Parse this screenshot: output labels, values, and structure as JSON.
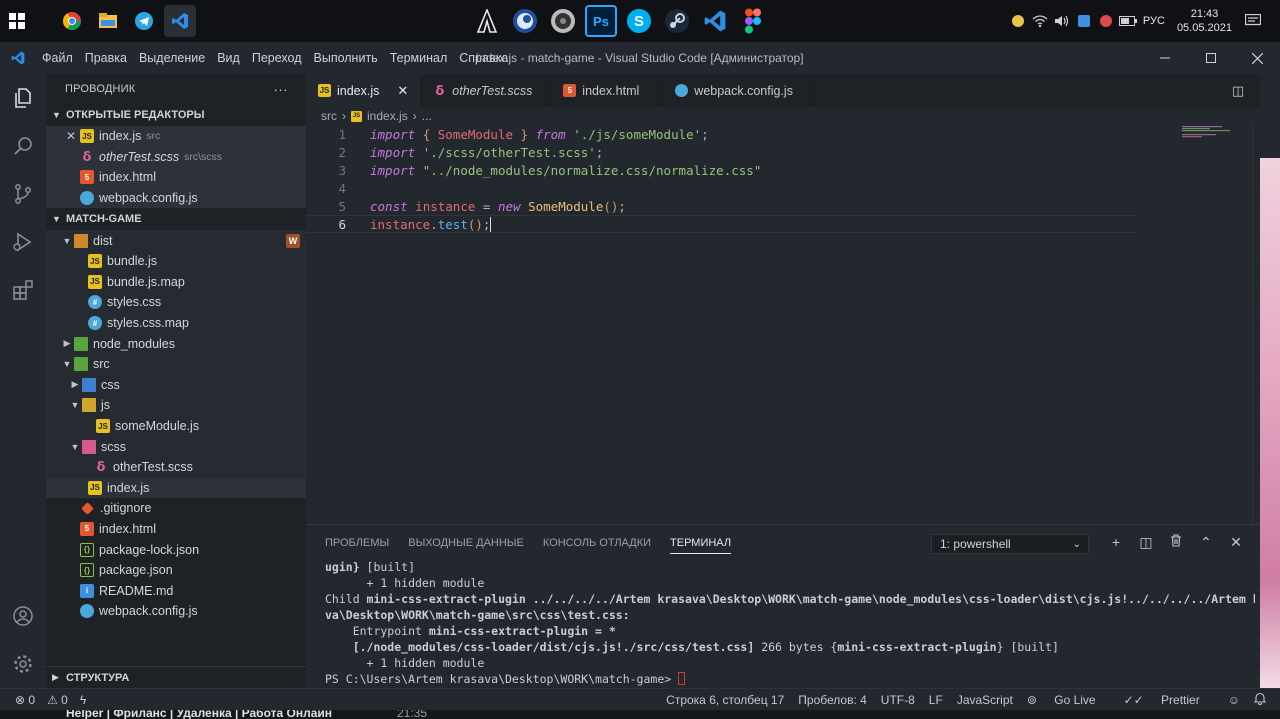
{
  "taskbar": {
    "tray_lang": "РУС",
    "time": "21:43",
    "date": "05.05.2021",
    "center_apps": [
      "assassins-icon",
      "cinema4d-icon",
      "audio-icon",
      "Ps",
      "S",
      "steam-icon",
      "vscode-icon",
      "figma-icon"
    ],
    "ps_label": "Ps",
    "skype_label": "S"
  },
  "window": {
    "title": "index.js - match-game - Visual Studio Code [Администратор]",
    "menu": [
      "Файл",
      "Правка",
      "Выделение",
      "Вид",
      "Переход",
      "Выполнить",
      "Терминал",
      "Справка"
    ]
  },
  "sidebar": {
    "header": "ПРОВОДНИК",
    "header_dots": "···",
    "open_editors_title": "ОТКРЫТЫЕ РЕДАКТОРЫ",
    "open_editors": [
      {
        "name": "index.js",
        "sub": "src",
        "type": "js"
      },
      {
        "name": "otherTest.scss",
        "sub": "src\\scss",
        "type": "scss"
      },
      {
        "name": "index.html",
        "sub": "",
        "type": "html"
      },
      {
        "name": "webpack.config.js",
        "sub": "",
        "type": "webpack"
      }
    ],
    "project_title": "MATCH-GAME",
    "tree": {
      "dist": "dist",
      "bundle_js": "bundle.js",
      "bundle_map": "bundle.js.map",
      "styles_css": "styles.css",
      "styles_map": "styles.css.map",
      "node_modules": "node_modules",
      "src": "src",
      "css": "css",
      "js": "js",
      "some_module": "someModule.js",
      "scss": "scss",
      "other_test": "otherTest.scss",
      "index_js": "index.js",
      "gitignore": ".gitignore",
      "index_html": "index.html",
      "package_lock": "package-lock.json",
      "package_json": "package.json",
      "readme": "README.md",
      "webpack": "webpack.config.js"
    },
    "dist_badge": "W",
    "footer": "СТРУКТУРА"
  },
  "editor": {
    "tabs": [
      {
        "label": "index.js",
        "active": true
      },
      {
        "label": "otherTest.scss",
        "active": false
      },
      {
        "label": "index.html",
        "active": false
      },
      {
        "label": "webpack.config.js",
        "active": false
      }
    ],
    "breadcrumb": [
      "src",
      "›",
      "index.js",
      "›",
      "..."
    ],
    "line_numbers": [
      "1",
      "2",
      "3",
      "4",
      "5",
      "6"
    ],
    "code": {
      "l1_import": "import",
      "l1_open": "{",
      "l1_name": "SomeModule",
      "l1_close": "}",
      "l1_from": "from",
      "l1_path": "'./js/someModule'",
      "l1_end": ";",
      "l2_import": "import",
      "l2_path": "'./scss/otherTest.scss'",
      "l2_end": ";",
      "l3_import": "import",
      "l3_path": "\"../node_modules/normalize.css/normalize.css\"",
      "l5_const": "const",
      "l5_var": "instance",
      "l5_eq": "=",
      "l5_new": "new",
      "l5_cls": "SomeModule",
      "l5_call": "()",
      "l5_end": ";",
      "l6_var": "instance",
      "l6_dot": ".",
      "l6_fn": "test",
      "l6_call": "()",
      "l6_end": ";"
    }
  },
  "panel": {
    "tabs": [
      "ПРОБЛЕМЫ",
      "ВЫХОДНЫЕ ДАННЫЕ",
      "КОНСОЛЬ ОТЛАДКИ",
      "ТЕРМИНАЛ"
    ],
    "active_tab": "ТЕРМИНАЛ",
    "terminal_select": "1: powershell",
    "terminal": {
      "t1a": "ugin}",
      "t1b": " [built]",
      "t2": "      + 1 hidden module",
      "t3a": "Child ",
      "t3b": "mini-css-extract-plugin ../../../../Artem krasava\\Desktop\\WORK\\match-game\\node_modules\\css-loader\\dist\\cjs.js!../../../../Artem krasa",
      "t4": "va\\Desktop\\WORK\\match-game\\src\\css\\test.css:",
      "t5a": "    Entrypoint ",
      "t5b": "mini-css-extract-plugin = *",
      "t6a": "    [./node_modules/css-loader/dist/cjs.js!./src/css/test.css]",
      "t6b": " 266 bytes {",
      "t6c": "mini-css-extract-plugin",
      "t6d": "} [built]",
      "t7": "      + 1 hidden module",
      "t8": "PS C:\\Users\\Artem krasava\\Desktop\\WORK\\match-game> "
    }
  },
  "statusbar": {
    "errors": "⊗ 0",
    "warnings": "⚠ 0",
    "position": "Строка 6, столбец 17",
    "spaces": "Пробелов: 4",
    "encoding": "UTF-8",
    "eol": "LF",
    "language": "JavaScript",
    "golive": "Go Live",
    "prettier": "Prettier"
  },
  "bottom_strip": {
    "text": "Helper | Фриланс | Удаленка | Работа Онлайн",
    "time": "21:35"
  },
  "colors": {
    "accent": "#2f8ee4",
    "editor_bg": "#23272e",
    "sidebar_bg": "#1e2227"
  }
}
